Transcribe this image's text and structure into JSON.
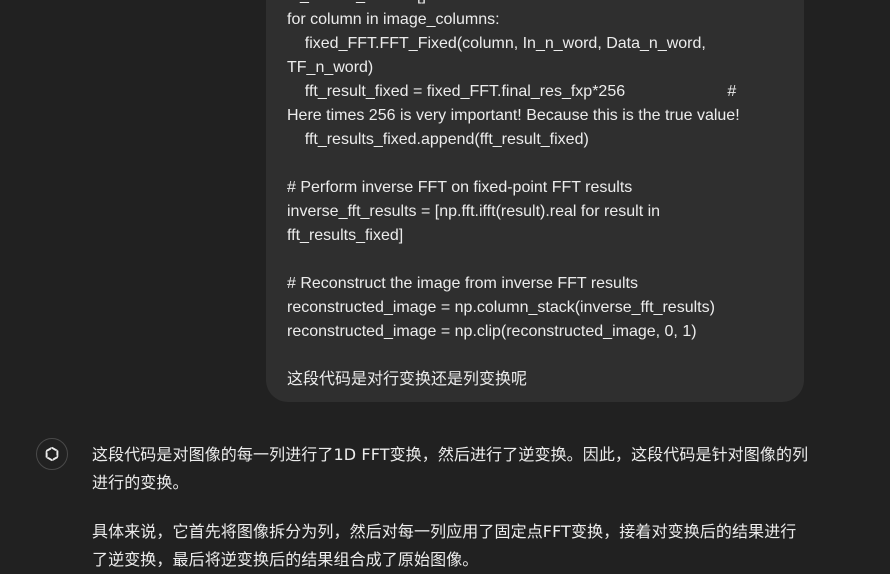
{
  "user_message": {
    "lines": [
      "fft_results_fixed = []",
      "for column in image_columns:",
      "    fixed_FFT.FFT_Fixed(column, In_n_word, Data_n_word,",
      "TF_n_word)",
      "    fft_result_fixed = fixed_FFT.final_res_fxp*256                       #",
      "Here times 256 is very important! Because this is the true value!",
      "    fft_results_fixed.append(fft_result_fixed)",
      "",
      "# Perform inverse FFT on fixed-point FFT results",
      "inverse_fft_results = [np.fft.ifft(result).real for result in",
      "fft_results_fixed]",
      "",
      "# Reconstruct the image from inverse FFT results",
      "reconstructed_image = np.column_stack(inverse_fft_results)",
      "reconstructed_image = np.clip(reconstructed_image, 0, 1)",
      "",
      "这段代码是对行变换还是列变换呢"
    ]
  },
  "assistant": {
    "avatar_icon": "openai-logo-icon",
    "paragraph_1": [
      "这段代码是对图像的每一列进行了1D FFT变换，然后进行了逆变换。因此，这段代码是针对图像的列",
      "进行的变换。"
    ],
    "paragraph_2": [
      "具体来说，它首先将图像拆分为列，然后对每一列应用了固定点FFT变换，接着对变换后的结果进行",
      "了逆变换，最后将逆变换后的结果组合成了原始图像。"
    ]
  },
  "colors": {
    "background": "#212121",
    "user_bubble": "#2f2f2f",
    "text": "#ececec"
  }
}
